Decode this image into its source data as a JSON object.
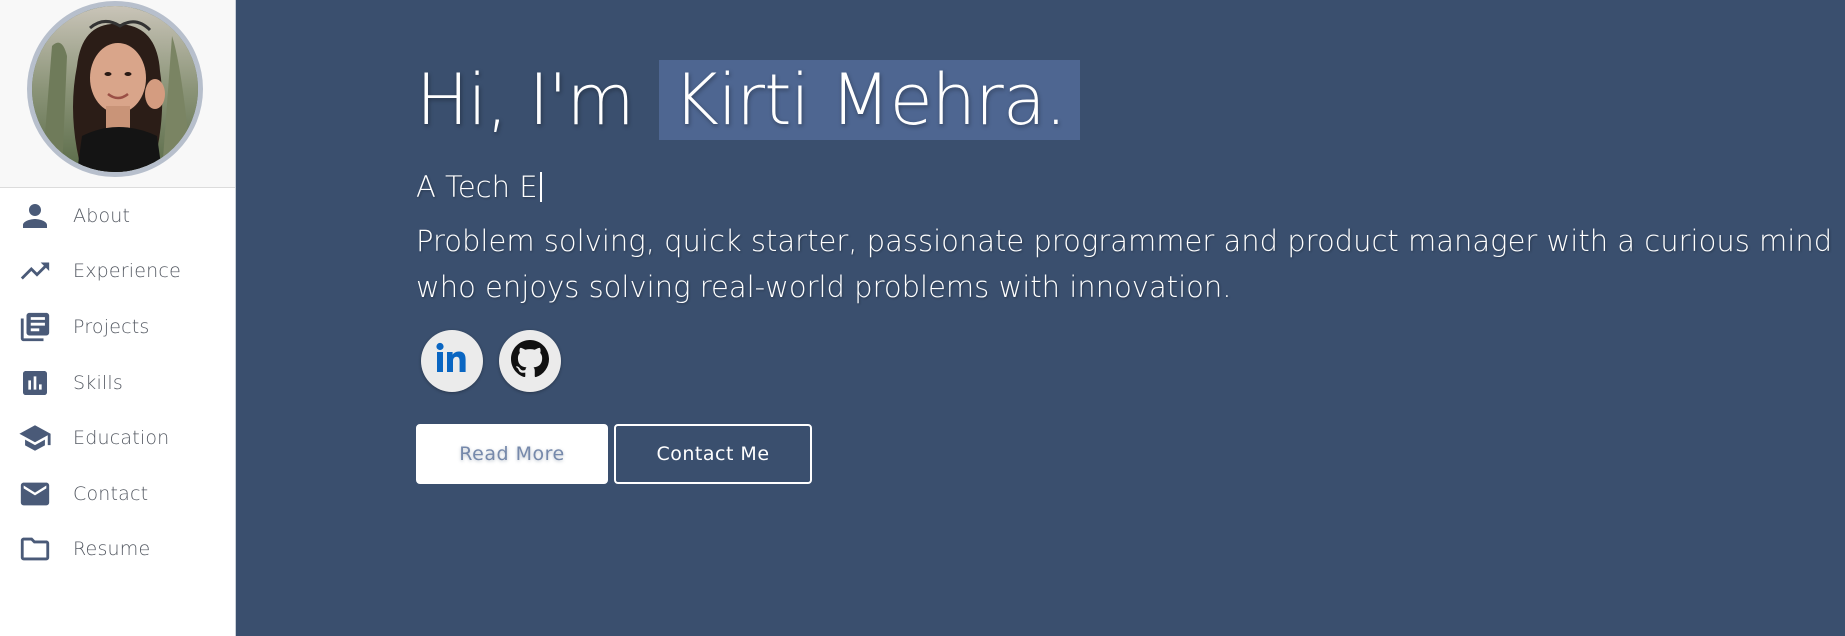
{
  "sidebar": {
    "items": [
      {
        "label": "About",
        "icon": "person-icon"
      },
      {
        "label": "Experience",
        "icon": "trending-up-icon"
      },
      {
        "label": "Projects",
        "icon": "library-books-icon"
      },
      {
        "label": "Skills",
        "icon": "bar-chart-icon"
      },
      {
        "label": "Education",
        "icon": "graduation-cap-icon"
      },
      {
        "label": "Contact",
        "icon": "mail-icon"
      },
      {
        "label": "Resume",
        "icon": "folder-icon"
      }
    ]
  },
  "hero": {
    "greeting": "Hi, I'm",
    "name": "Kirti Mehra.",
    "typed_subtitle": "A Tech E",
    "bio": "Problem solving, quick starter, passionate programmer and product manager with a curious mind who enjoys solving real-world problems with innovation.",
    "socials": [
      {
        "name": "LinkedIn",
        "icon": "linkedin-icon"
      },
      {
        "name": "GitHub",
        "icon": "github-icon"
      }
    ],
    "read_more_label": "Read More",
    "contact_label": "Contact Me"
  },
  "colors": {
    "main_bg": "#3a4f6e",
    "name_highlight": "#4e6691",
    "icon": "#4a5a78",
    "linkedin": "#0a66c2"
  }
}
